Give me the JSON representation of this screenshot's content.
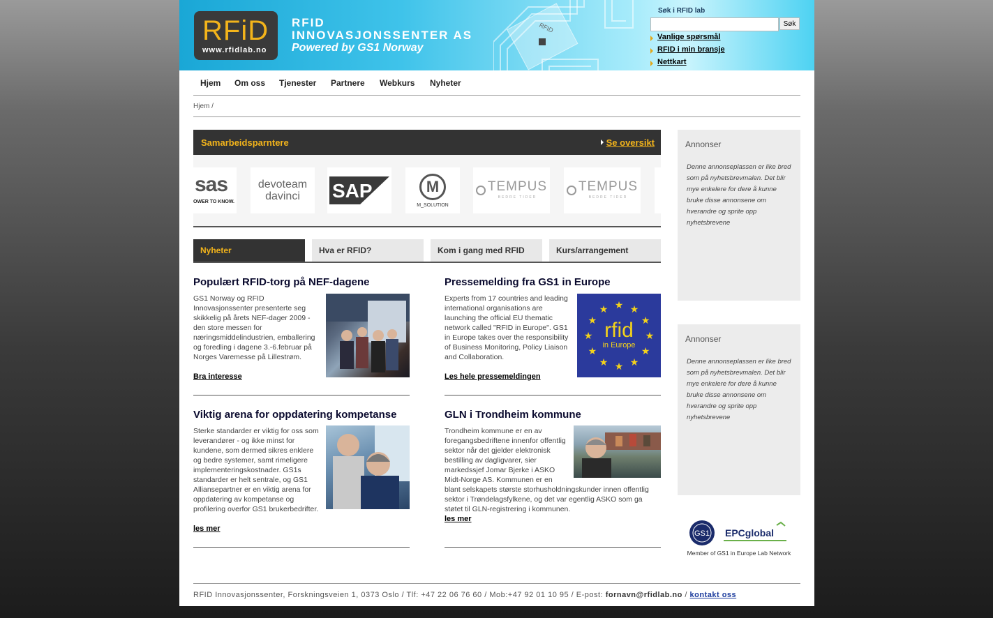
{
  "header": {
    "logo_text": "RFiD",
    "logo_url": "www.rfidlab.no",
    "title_line1": "RFID",
    "title_line2": "INNOVASJONSSENTER AS",
    "subtitle": "Powered by GS1 Norway",
    "chip_label": "RFID",
    "search_label": "Søk i RFID lab",
    "search_value": "",
    "search_button": "Søk",
    "quick_links": [
      "Vanlige spørsmål",
      "RFID i min bransje",
      "Nettkart"
    ]
  },
  "nav": [
    "Hjem",
    "Om oss",
    "Tjenester",
    "Partnere",
    "Webkurs",
    "Nyheter"
  ],
  "breadcrumb": "Hjem /",
  "partners": {
    "title": "Samarbeidsparntere",
    "link": "Se oversikt",
    "logos": [
      {
        "name": "sas",
        "text": "sas",
        "sub": "OWER TO KNOW."
      },
      {
        "name": "devoteam",
        "text": "devoteam",
        "sub": "davinci"
      },
      {
        "name": "sap",
        "text": "SAP"
      },
      {
        "name": "m-solution",
        "text": "M",
        "sub": "M_SOLUTION"
      },
      {
        "name": "tempus-1",
        "text": "TEMPUS",
        "sub": "BEDRE TIDER"
      },
      {
        "name": "tempus-2",
        "text": "TEMPUS",
        "sub": "BEDRE TIDER"
      }
    ]
  },
  "tabs": [
    "Nyheter",
    "Hva er RFID?",
    "Kom i gang med RFID",
    "Kurs/arrangement"
  ],
  "articles": [
    {
      "title": "Populært RFID-torg på NEF-dagene",
      "text": "GS1 Norway og RFID Innovasjonssenter presenterte seg skikkelig på årets NEF-dager 2009 - den store messen for næringsmiddelindustrien, emballering og foredling i dagene 3.-6.februar på Norges Varemesse på Lillestrøm.",
      "link": "Bra interesse"
    },
    {
      "title": "Pressemelding fra GS1 in Europe",
      "text": "Experts from 17 countries and leading international organisations are launching the official EU thematic network called \"RFID in Europe\". GS1 in Europe takes over the responsibility of Business Monitoring, Policy Liaison and Collaboration.",
      "link": "Les hele pressemeldingen",
      "image_word": "rfid",
      "image_sub": "in Europe"
    },
    {
      "title": "Viktig arena for oppdatering kompetanse",
      "text": "Sterke standarder er viktig for oss som leverandører - og ikke minst for kundene, som dermed sikres enklere og bedre systemer, samt rimeligere implementeringskostnader. GS1s standarder er helt sentrale, og GS1 Alliansepartner er en viktig arena for oppdatering av kompetanse og profilering overfor GS1 brukerbedrifter.",
      "link": "les mer"
    },
    {
      "title": "GLN i Trondheim kommune",
      "text_top": "Trondheim kommune er en av foregangsbedriftene innenfor offentlig sektor når det gjelder elektronisk bestilling av dagligvarer, sier markedssjef Jomar Bjerke i ASKO Midt-Norge AS. Kommunen er en",
      "text_bottom": "blant selskapets største storhusholdningskunder innen offentlig sektor i Trøndelagsfylkene, og det var egentlig ASKO som ga støtet til GLN-registrering i kommunen.",
      "link": "les mer"
    }
  ],
  "sidebar": {
    "ads": [
      {
        "title": "Annonser",
        "text": "Denne annonseplassen er like bred som på nyhetsbrevmalen. Det blir mye enkelere for dere å kunne bruke disse annonsene om hverandre og sprite opp nyhetsbrevene"
      },
      {
        "title": "Annonser",
        "text": "Denne annonseplassen er like bred som på nyhetsbrevmalen. Det blir mye enkelere for dere å kunne bruke disse annonsene om hverandre og sprite opp nyhetsbrevene"
      }
    ],
    "gs1_text": "GS1",
    "epc_text": "EPCglobal",
    "member_text": "Member of GS1 in Europe Lab Network"
  },
  "footer": {
    "address": "RFID Innovasjonssenter, Forskningsveien 1, 0373 Oslo / Tlf: +47 22 06 76 60 / Mob:+47 92 01 10 95 / E-post: ",
    "email": "fornavn@rfidlab.no",
    "sep": " / ",
    "contact": "kontakt oss"
  },
  "colors": {
    "accent": "#f3b41b",
    "dark_bar": "#333333",
    "header_blue": "#3fc3ea",
    "eu_blue": "#2b3a9c"
  }
}
